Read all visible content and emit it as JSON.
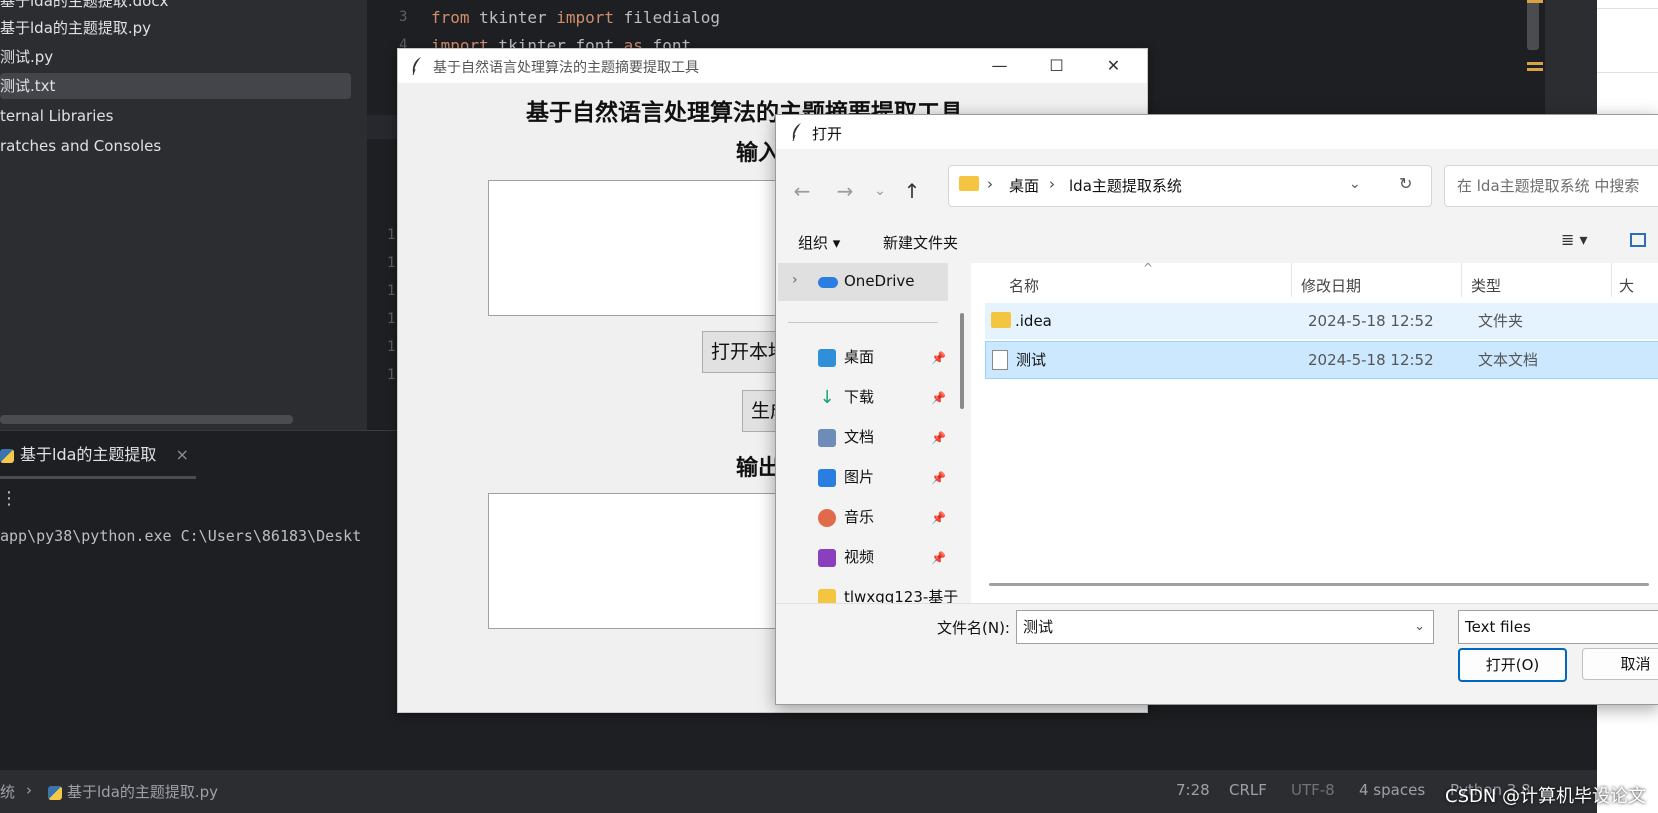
{
  "ide": {
    "project_tree": [
      "基于lda的主题提取.docx",
      "基于lda的主题提取.py",
      "测试.py",
      "测试.txt",
      "ternal Libraries",
      "ratches and Consoles"
    ],
    "gutter": [
      "3",
      "4",
      "1",
      "1",
      "1",
      "1",
      "1",
      "1"
    ],
    "code_line3": {
      "kw1": "from",
      "mod": " tkinter ",
      "kw2": "import",
      "name": " filedialog"
    },
    "code_line4": {
      "kw1": "import",
      "mod": " tkinter.font ",
      "kw2": "as",
      "name": " font"
    },
    "run_tab_label": "基于lda的主题提取",
    "run_tab_close": "×",
    "run_menu": "⋮",
    "run_output": "app\\py38\\python.exe C:\\Users\\86183\\Deskt",
    "status": {
      "breadcrumb_prefix": "统",
      "breadcrumb_sep": "›",
      "file": "基于lda的主题提取.py",
      "position": "7:28",
      "line_sep": "CRLF",
      "encoding": "UTF-8",
      "indent": "4 spaces",
      "interpreter": "Python 3.8"
    }
  },
  "tk_window": {
    "title": "基于自然语言处理算法的主题摘要提取工具",
    "heading": "基于自然语言处理算法的主题摘要提取工具",
    "input_label": "输入",
    "open_button": "打开本地",
    "generate_button": "生成",
    "output_label": "输出",
    "controls": {
      "minimize": "—",
      "maximize": "☐",
      "close": "✕"
    }
  },
  "open_dialog": {
    "title": "打开",
    "address": {
      "crumb1": "桌面",
      "crumb2": "lda主题提取系统",
      "sep": "›"
    },
    "search_placeholder": "在 lda主题提取系统 中搜索",
    "toolbar": {
      "organize": "组织 ▾",
      "new_folder": "新建文件夹",
      "view": "≣ ▾"
    },
    "nav": {
      "onedrive": "OneDrive",
      "items": [
        "桌面",
        "下载",
        "文档",
        "图片",
        "音乐",
        "视频",
        "tlwxgq123-基于"
      ]
    },
    "columns": {
      "name": "名称",
      "date": "修改日期",
      "type": "类型",
      "size": "大"
    },
    "files": [
      {
        "name": ".idea",
        "date": "2024-5-18 12:52",
        "type": "文件夹"
      },
      {
        "name": "测试",
        "date": "2024-5-18 12:52",
        "type": "文本文档"
      }
    ],
    "filename_label": "文件名(N):",
    "filename_value": "测试",
    "filetype_value": "Text files",
    "open_button": "打开(O)",
    "cancel_button": "取消"
  },
  "watermark": "CSDN @计算机毕设论文"
}
